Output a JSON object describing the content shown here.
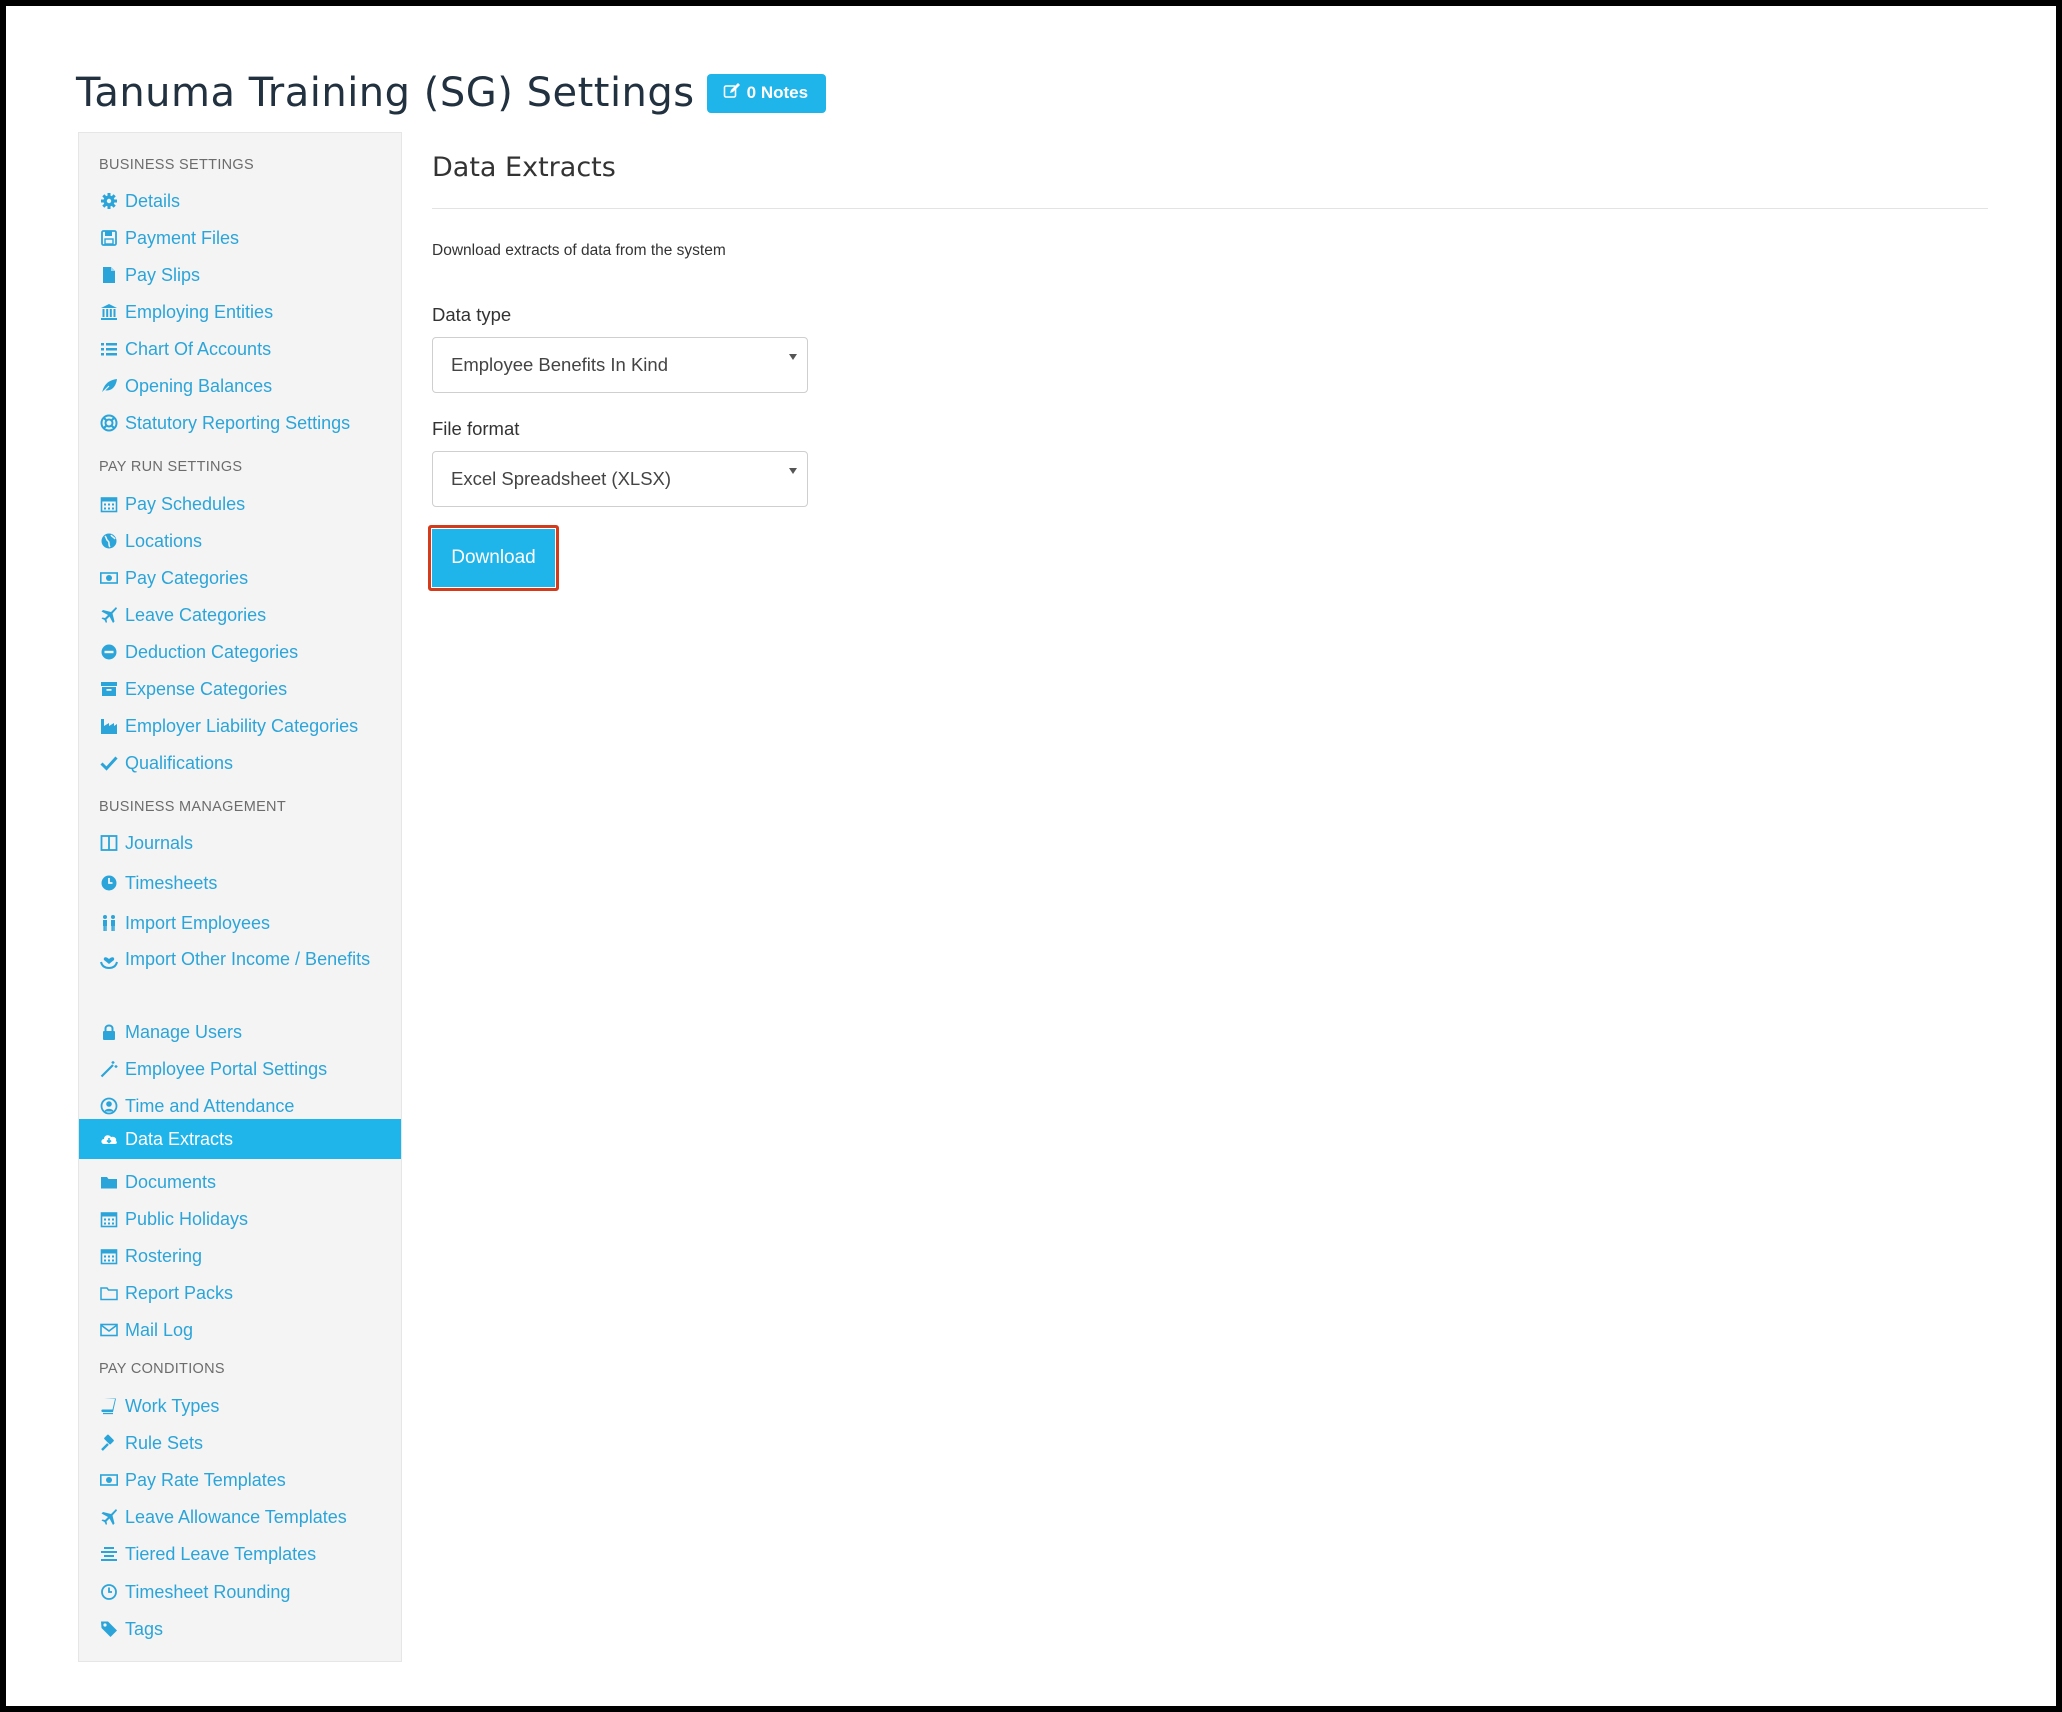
{
  "page": {
    "title": "Tanuma Training (SG) Settings",
    "notes_label": "0 Notes",
    "accent_color": "#1fb4ea",
    "link_color": "#2ba5d9"
  },
  "sidebar": {
    "sections": [
      {
        "title": "BUSINESS SETTINGS",
        "items": [
          {
            "label": "Details",
            "icon": "gear-icon"
          },
          {
            "label": "Payment Files",
            "icon": "floppy-icon"
          },
          {
            "label": "Pay Slips",
            "icon": "file-icon"
          },
          {
            "label": "Employing Entities",
            "icon": "bank-icon"
          },
          {
            "label": "Chart Of Accounts",
            "icon": "list-icon"
          },
          {
            "label": "Opening Balances",
            "icon": "leaf-icon"
          },
          {
            "label": "Statutory Reporting Settings",
            "icon": "lifebuoy-icon"
          }
        ]
      },
      {
        "title": "PAY RUN SETTINGS",
        "items": [
          {
            "label": "Pay Schedules",
            "icon": "calendar-icon"
          },
          {
            "label": "Locations",
            "icon": "globe-icon"
          },
          {
            "label": "Pay Categories",
            "icon": "money-icon"
          },
          {
            "label": "Leave Categories",
            "icon": "plane-icon"
          },
          {
            "label": "Deduction Categories",
            "icon": "minus-circle-icon"
          },
          {
            "label": "Expense Categories",
            "icon": "archive-icon"
          },
          {
            "label": "Employer Liability Categories",
            "icon": "industry-icon"
          },
          {
            "label": "Qualifications",
            "icon": "check-icon"
          }
        ]
      },
      {
        "title": "BUSINESS MANAGEMENT",
        "items": [
          {
            "label": "Journals",
            "icon": "columns-icon"
          },
          {
            "label": "Timesheets",
            "icon": "clock-icon"
          },
          {
            "label": "Import Employees",
            "icon": "people-icon"
          },
          {
            "label": "Import Other Income / Benefits",
            "icon": "hand-heart-icon"
          },
          {
            "label": "Manage Users",
            "icon": "lock-icon"
          },
          {
            "label": "Employee Portal Settings",
            "icon": "magic-wand-icon"
          },
          {
            "label": "Time and Attendance",
            "icon": "user-circle-icon"
          },
          {
            "label": "Data Extracts",
            "icon": "cloud-download-icon"
          },
          {
            "label": "Documents",
            "icon": "folder-icon"
          },
          {
            "label": "Public Holidays",
            "icon": "calendar-icon"
          },
          {
            "label": "Rostering",
            "icon": "calendar-icon"
          },
          {
            "label": "Report Packs",
            "icon": "folder-open-icon"
          },
          {
            "label": "Mail Log",
            "icon": "envelope-icon"
          }
        ]
      },
      {
        "title": "PAY CONDITIONS",
        "items": [
          {
            "label": "Work Types",
            "icon": "book-icon"
          },
          {
            "label": "Rule Sets",
            "icon": "gavel-icon"
          },
          {
            "label": "Pay Rate Templates",
            "icon": "money-icon"
          },
          {
            "label": "Leave Allowance Templates",
            "icon": "plane-icon"
          },
          {
            "label": "Tiered Leave Templates",
            "icon": "align-center-icon"
          },
          {
            "label": "Timesheet Rounding",
            "icon": "clock-outline-icon"
          },
          {
            "label": "Tags",
            "icon": "tag-icon"
          }
        ]
      }
    ]
  },
  "main": {
    "title": "Data Extracts",
    "description": "Download extracts of data from the system",
    "data_type_label": "Data type",
    "data_type_value": "Employee Benefits In Kind",
    "file_format_label": "File format",
    "file_format_value": "Excel Spreadsheet (XLSX)",
    "download_label": "Download"
  }
}
